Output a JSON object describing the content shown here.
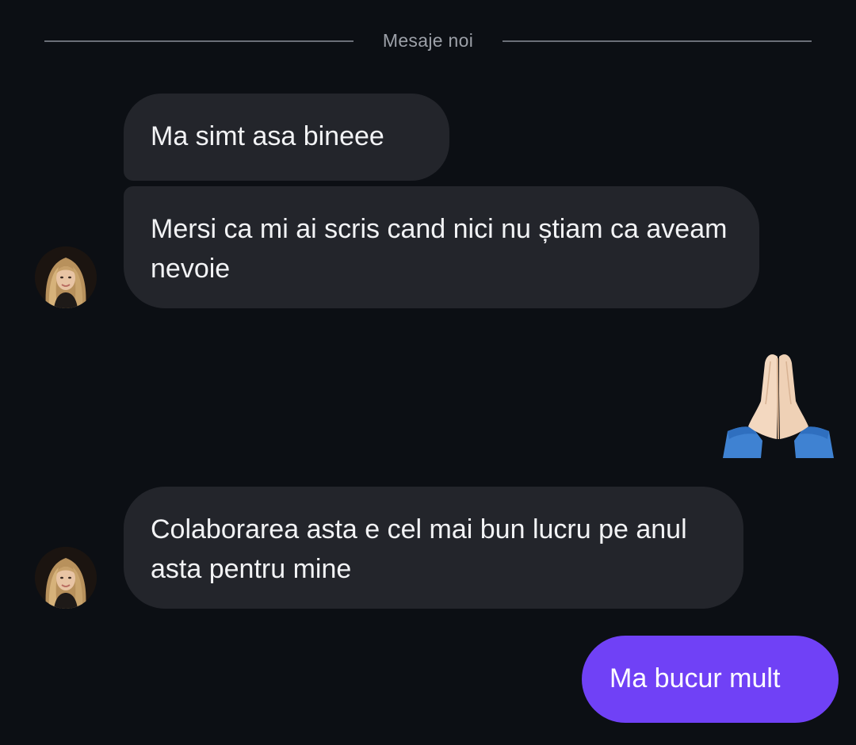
{
  "divider": {
    "label": "Mesaje noi"
  },
  "messages": [
    {
      "sender": "contact",
      "text": "Ma simt asa bineee"
    },
    {
      "sender": "contact",
      "text": "Mersi ca mi ai scris cand nici nu știam ca aveam nevoie"
    },
    {
      "sender": "me",
      "type": "emoji",
      "icon": "folded-hands-icon",
      "text": "🙏"
    },
    {
      "sender": "contact",
      "text": "Colaborarea asta e cel mai bun lucru pe anul asta pentru mine"
    },
    {
      "sender": "me",
      "text": "Ma bucur mult"
    }
  ],
  "colors": {
    "background": "#0c0f14",
    "incoming_bubble": "#23252b",
    "outgoing_bubble": "#7041f6",
    "divider": "#6b6f78"
  }
}
